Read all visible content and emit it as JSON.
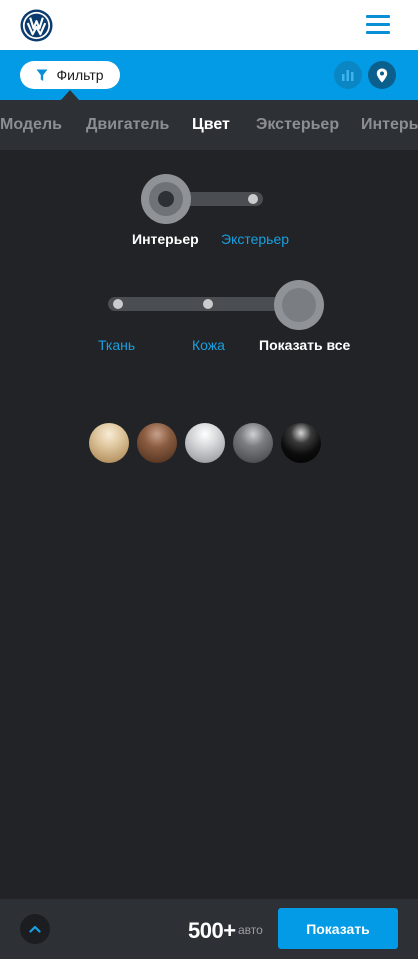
{
  "header": {
    "logo_icon": "vw-logo-icon",
    "menu_icon": "hamburger-menu-icon",
    "brand_color": "#0a8fd6"
  },
  "filterbar": {
    "filter_label": "Фильтр",
    "filter_icon": "funnel-icon",
    "stats_icon": "bar-chart-icon",
    "map_icon": "map-pin-icon",
    "background": "#039be5"
  },
  "tabs": [
    {
      "label": "Модель",
      "active": false
    },
    {
      "label": "Двигатель",
      "active": false
    },
    {
      "label": "Цвет",
      "active": true
    },
    {
      "label": "Экстерьер",
      "active": false
    },
    {
      "label": "Интерьер",
      "active": false
    }
  ],
  "view_toggle": {
    "options": [
      "Интерьер",
      "Экстерьер"
    ],
    "selected": "Интерьер"
  },
  "material_toggle": {
    "options": [
      "Ткань",
      "Кожа",
      "Показать все"
    ],
    "selected": "Показать все"
  },
  "swatches": [
    {
      "name": "beige",
      "color": "#d4b98f"
    },
    {
      "name": "brown",
      "color": "#7a5038"
    },
    {
      "name": "silver",
      "color": "#c2c3c5"
    },
    {
      "name": "grey",
      "color": "#6a6b6d"
    },
    {
      "name": "black",
      "color": "#0a0a0a"
    }
  ],
  "bottombar": {
    "count": "500+",
    "count_unit": "авто",
    "show_label": "Показать",
    "up_icon": "chevron-up-icon"
  }
}
